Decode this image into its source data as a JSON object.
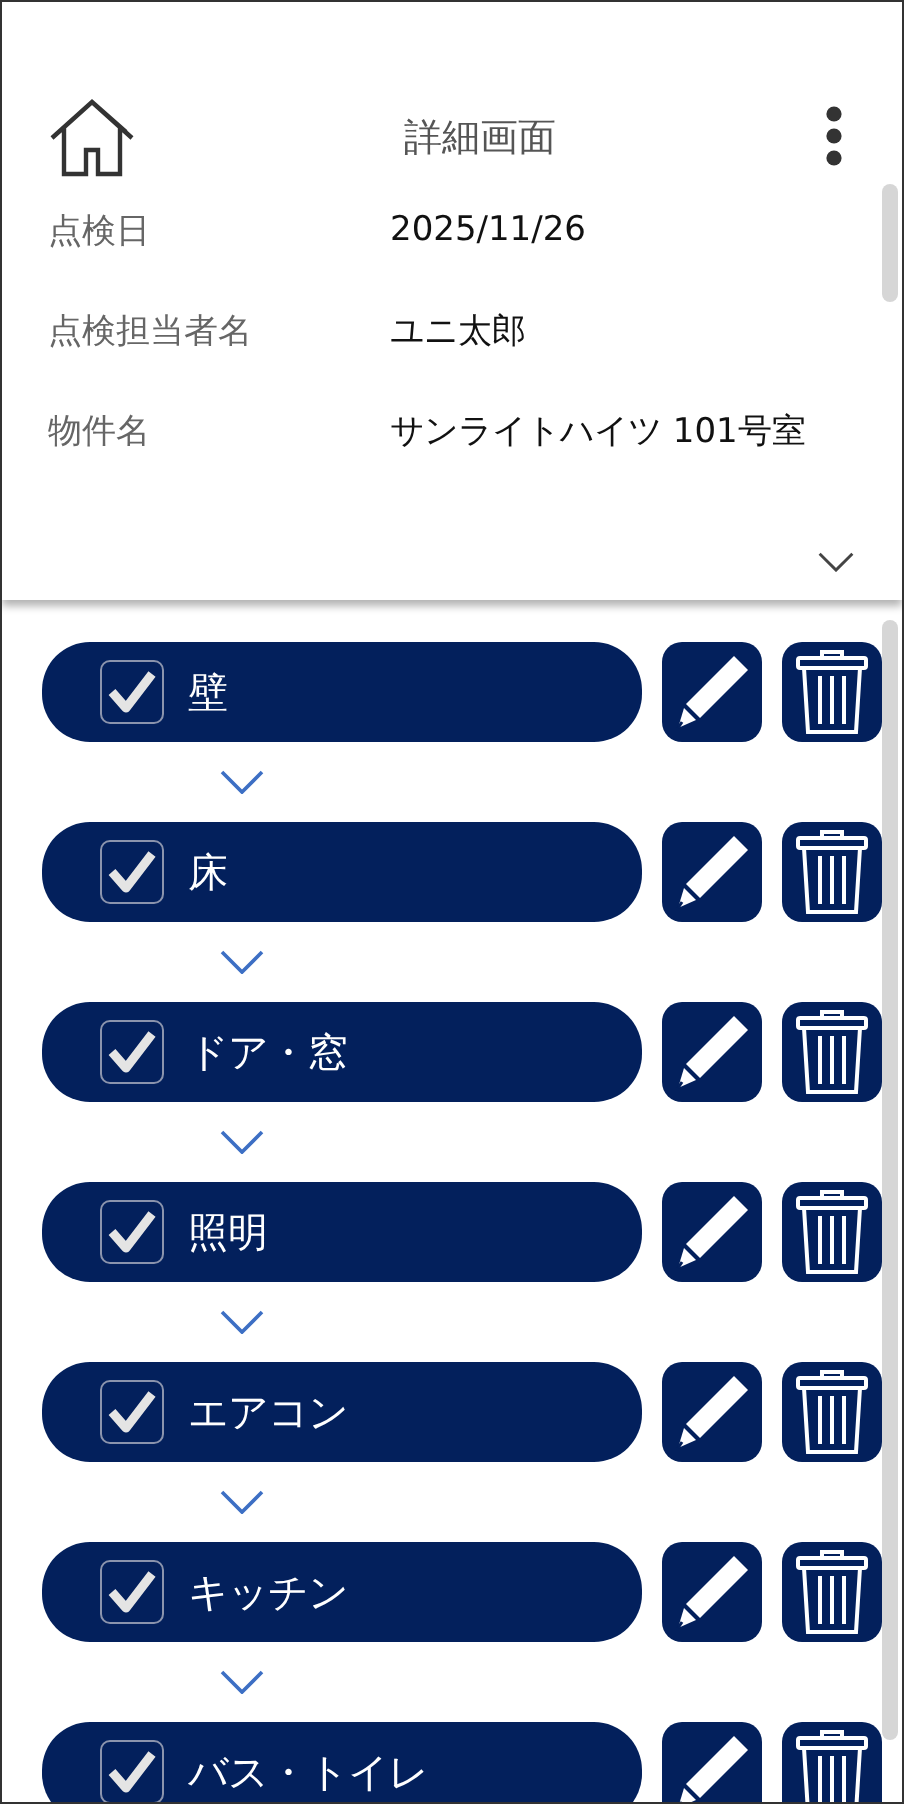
{
  "header": {
    "title": "詳細画面"
  },
  "info": [
    {
      "label": "点検日",
      "value": "2025/11/26"
    },
    {
      "label": "点検担当者名",
      "value": "ユニ太郎"
    },
    {
      "label": "物件名",
      "value": "サンライトハイツ 101号室"
    }
  ],
  "items": [
    {
      "label": "壁",
      "checked": true
    },
    {
      "label": "床",
      "checked": true
    },
    {
      "label": "ドア・窓",
      "checked": true
    },
    {
      "label": "照明",
      "checked": true
    },
    {
      "label": "エアコン",
      "checked": true
    },
    {
      "label": "キッチン",
      "checked": true
    },
    {
      "label": "バス・トイレ",
      "checked": true
    }
  ]
}
